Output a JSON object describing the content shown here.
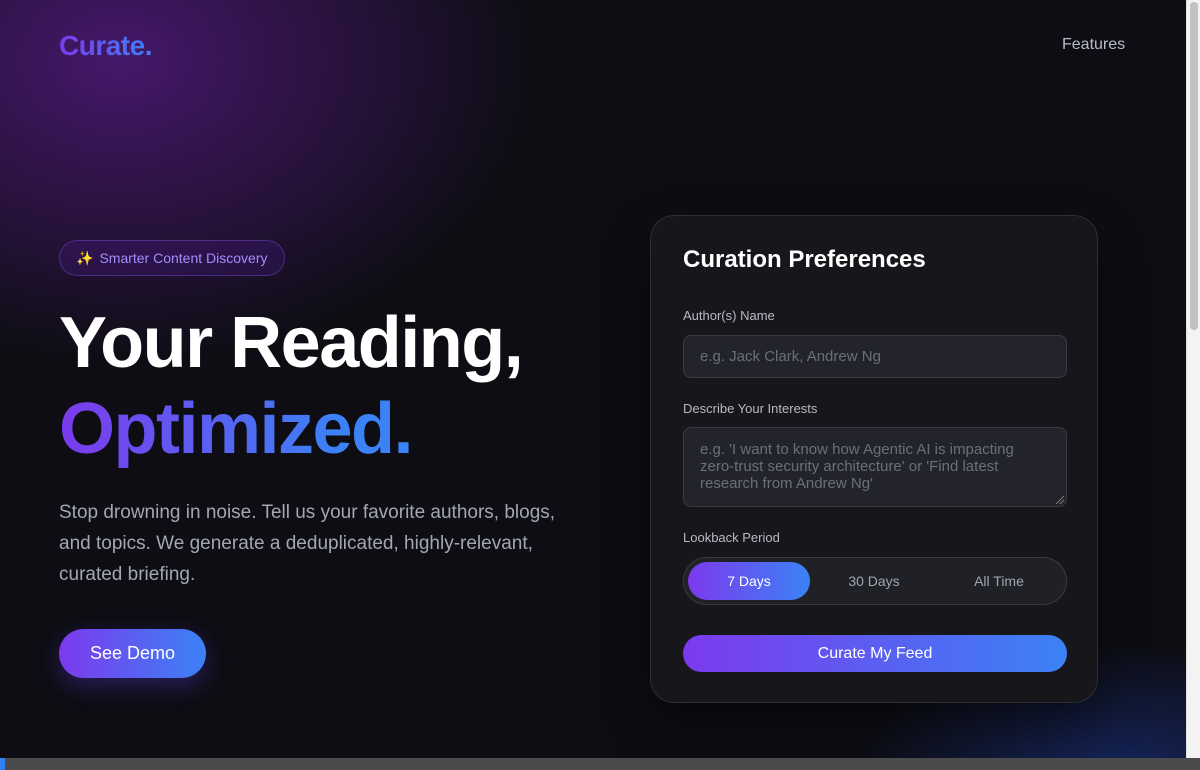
{
  "brand": {
    "logo_text": "Curate."
  },
  "nav": {
    "features_label": "Features"
  },
  "hero": {
    "badge_icon": "sparkles-icon",
    "badge_text": "Smarter Content Discovery",
    "title_line1": "Your Reading,",
    "title_line2": "Optimized.",
    "lead": "Stop drowning in noise. Tell us your favorite authors, blogs, and topics. We generate a deduplicated, highly-relevant, curated briefing.",
    "demo_button": "See Demo"
  },
  "form": {
    "title": "Curation Preferences",
    "authors_label": "Author(s) Name",
    "authors_placeholder": "e.g. Jack Clark, Andrew Ng",
    "interests_label": "Describe Your Interests",
    "interests_placeholder": "e.g. 'I want to know how Agentic AI is impacting zero-trust security architecture' or 'Find latest research from Andrew Ng'",
    "lookback_label": "Lookback Period",
    "lookback_options": [
      "7 Days",
      "30 Days",
      "All Time"
    ],
    "lookback_selected": "7 Days",
    "submit_label": "Curate My Feed"
  },
  "colors": {
    "accent_start": "#7c3aed",
    "accent_end": "#3b82f6",
    "background": "#0d0d13",
    "card": "#16161b"
  }
}
